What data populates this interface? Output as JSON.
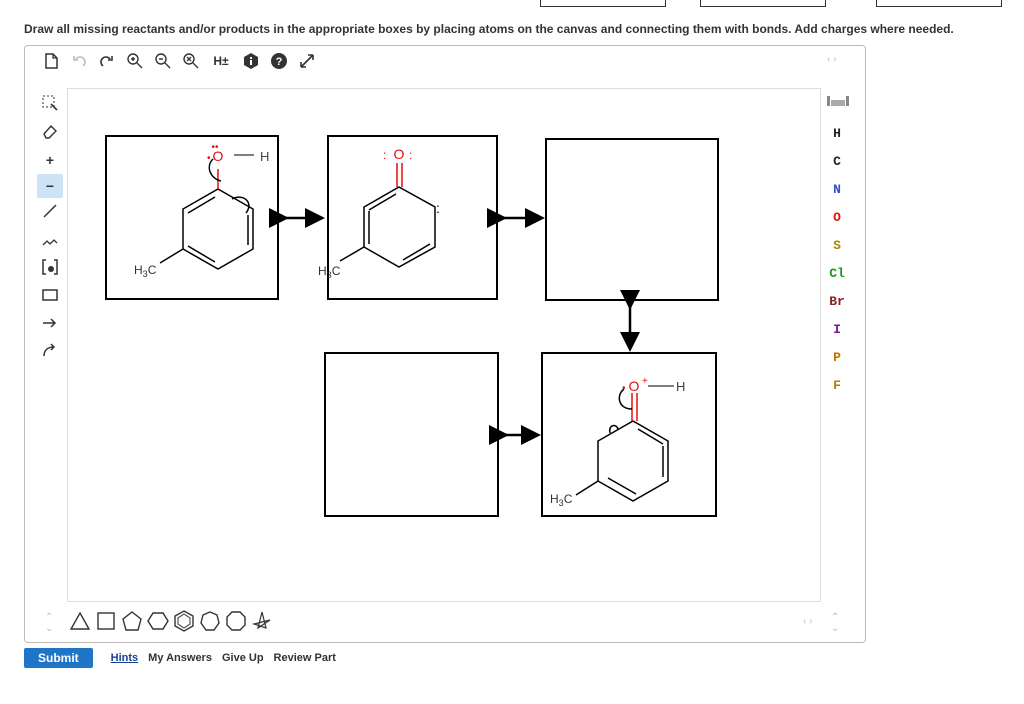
{
  "instruction": "Draw all missing reactants and/or products in the appropriate boxes by placing atoms on the canvas and connecting them with bonds. Add charges where needed.",
  "toolbar": {
    "icons": [
      "new-document-icon",
      "undo-icon",
      "redo-icon",
      "zoom-in-icon",
      "zoom-out-icon",
      "zoom-reset-icon",
      "hydrogen-toggle-icon",
      "info-icon",
      "help-icon",
      "fullscreen-icon"
    ],
    "h_label": "H±"
  },
  "left_tools": {
    "plus_label": "+",
    "minus_label": "−"
  },
  "elements": [
    {
      "symbol": "H",
      "color": "#222222"
    },
    {
      "symbol": "C",
      "color": "#222222"
    },
    {
      "symbol": "N",
      "color": "#3050c8"
    },
    {
      "symbol": "O",
      "color": "#e01010"
    },
    {
      "symbol": "S",
      "color": "#a08a00"
    },
    {
      "symbol": "Cl",
      "color": "#1a9a1a"
    },
    {
      "symbol": "Br",
      "color": "#8a2020"
    },
    {
      "symbol": "I",
      "color": "#7a1a9a"
    },
    {
      "symbol": "P",
      "color": "#c07000"
    },
    {
      "symbol": "F",
      "color": "#b08000"
    }
  ],
  "molecules": {
    "box1": {
      "o_label": "O",
      "h_label": "H",
      "ch3_label": "H",
      "ch3_sub": "3",
      "ch3_c": "C"
    },
    "box2": {
      "o_label": "O",
      "ch3_label": "H",
      "ch3_sub": "3",
      "ch3_c": "C"
    },
    "box5": {
      "o_label": "O",
      "o_charge": "+",
      "h_label": "H",
      "ch3_label": "H",
      "ch3_sub": "3",
      "ch3_c": "C"
    }
  },
  "actions": {
    "submit": "Submit",
    "hints": "Hints",
    "my_answers": "My Answers",
    "give_up": "Give Up",
    "review_part": "Review Part"
  }
}
